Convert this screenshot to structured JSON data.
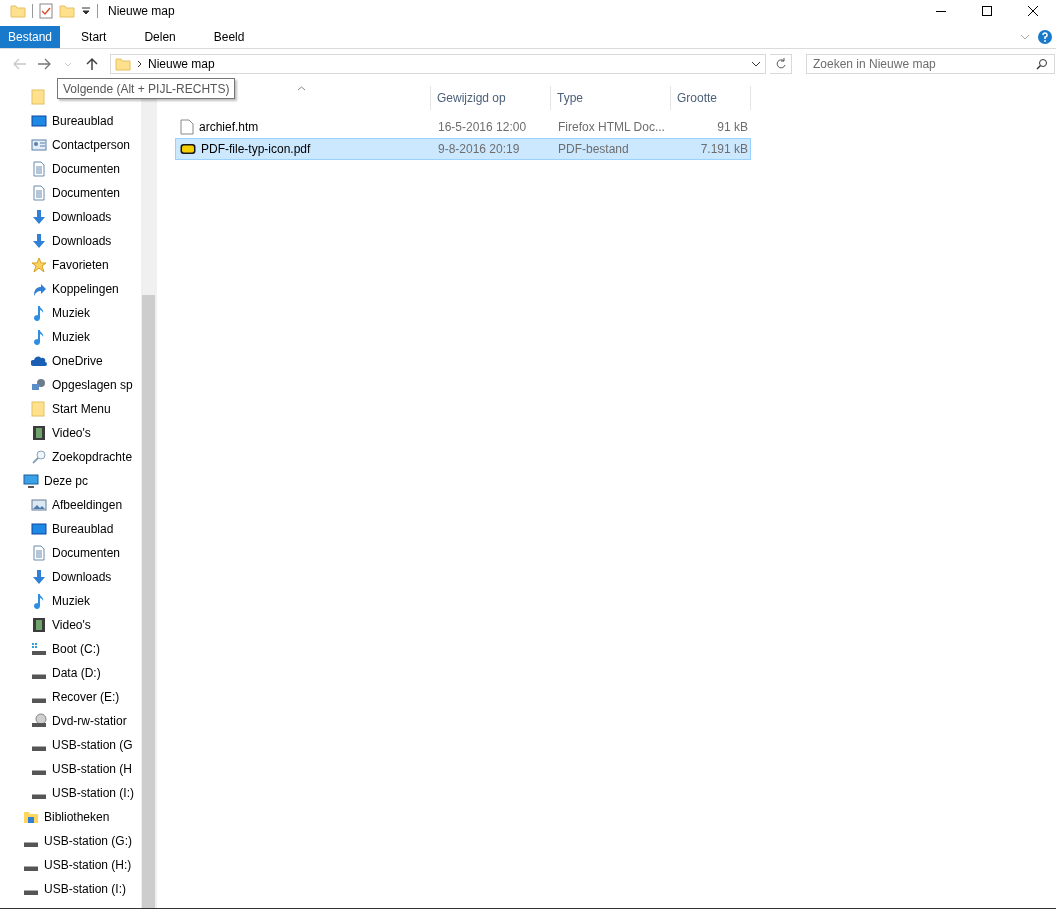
{
  "window": {
    "title": "Nieuwe map"
  },
  "ribbon": {
    "tabs": [
      {
        "label": "Bestand",
        "kind": "file"
      },
      {
        "label": "Start",
        "kind": "tab"
      },
      {
        "label": "Delen",
        "kind": "tab"
      },
      {
        "label": "Beeld",
        "kind": "tab"
      }
    ]
  },
  "navigation": {
    "back_disabled": true,
    "forward_disabled": false,
    "path": [
      "Nieuwe map"
    ],
    "search": {
      "placeholder": "Zoeken in Nieuwe map"
    }
  },
  "tooltip": "Volgende (Alt + PIJL-RECHTS)",
  "sidebar": {
    "items": [
      {
        "children": [
          {
            "kind": "folder"
          },
          {
            "label": "Bureaublad",
            "kind": "desktop"
          },
          {
            "label": "Contactperson",
            "kind": "contact"
          },
          {
            "label": "Documenten",
            "kind": "document"
          },
          {
            "label": "Documenten",
            "kind": "document"
          },
          {
            "label": "Downloads",
            "kind": "download"
          },
          {
            "label": "Downloads",
            "kind": "download"
          },
          {
            "label": "Favorieten",
            "kind": "star"
          },
          {
            "label": "Koppelingen",
            "kind": "link"
          },
          {
            "label": "Muziek",
            "kind": "music"
          },
          {
            "label": "Muziek",
            "kind": "music"
          },
          {
            "label": "OneDrive",
            "kind": "cloud"
          },
          {
            "label": "Opgeslagen sp",
            "kind": "search-puzzle"
          },
          {
            "label": "Start Menu",
            "kind": "folder"
          },
          {
            "label": "Video's",
            "kind": "video"
          },
          {
            "label": "Zoekopdrachte",
            "kind": "search"
          }
        ]
      },
      {
        "label": "Deze pc",
        "kind": "pc",
        "children": [
          {
            "label": "Afbeeldingen",
            "kind": "image"
          },
          {
            "label": "Bureaublad",
            "kind": "desktop"
          },
          {
            "label": "Documenten",
            "kind": "document"
          },
          {
            "label": "Downloads",
            "kind": "download"
          },
          {
            "label": "Muziek",
            "kind": "music"
          },
          {
            "label": "Video's",
            "kind": "video"
          },
          {
            "label": "Boot (C:)",
            "kind": "os-drive"
          },
          {
            "label": "Data (D:)",
            "kind": "drive"
          },
          {
            "label": "Recover (E:)",
            "kind": "drive"
          },
          {
            "label": "Dvd-rw-statior",
            "kind": "dvd"
          },
          {
            "label": "USB-station (G",
            "kind": "drive"
          },
          {
            "label": "USB-station (H",
            "kind": "drive"
          },
          {
            "label": "USB-station (I:)",
            "kind": "drive"
          }
        ]
      },
      {
        "label": "Bibliotheken",
        "kind": "library"
      },
      {
        "label": "USB-station (G:)",
        "kind": "drive"
      },
      {
        "label": "USB-station (H:)",
        "kind": "drive"
      },
      {
        "label": "USB-station (I:)",
        "kind": "drive"
      }
    ]
  },
  "table": {
    "columns": [
      {
        "sorted": true
      },
      {
        "label": "Gewijzigd op"
      },
      {
        "label": "Type"
      },
      {
        "label": "Grootte"
      }
    ],
    "rows": [
      {
        "name": "archief.htm",
        "kind": "htm",
        "modified": "16-5-2016 12:00",
        "type": "Firefox HTML Doc...",
        "size": "91 kB",
        "selected": false
      },
      {
        "name": "PDF-file-typ-icon.pdf",
        "kind": "pdf",
        "modified": "9-8-2016 20:19",
        "type": "PDF-bestand",
        "size": "7.191 kB",
        "selected": true
      }
    ]
  }
}
